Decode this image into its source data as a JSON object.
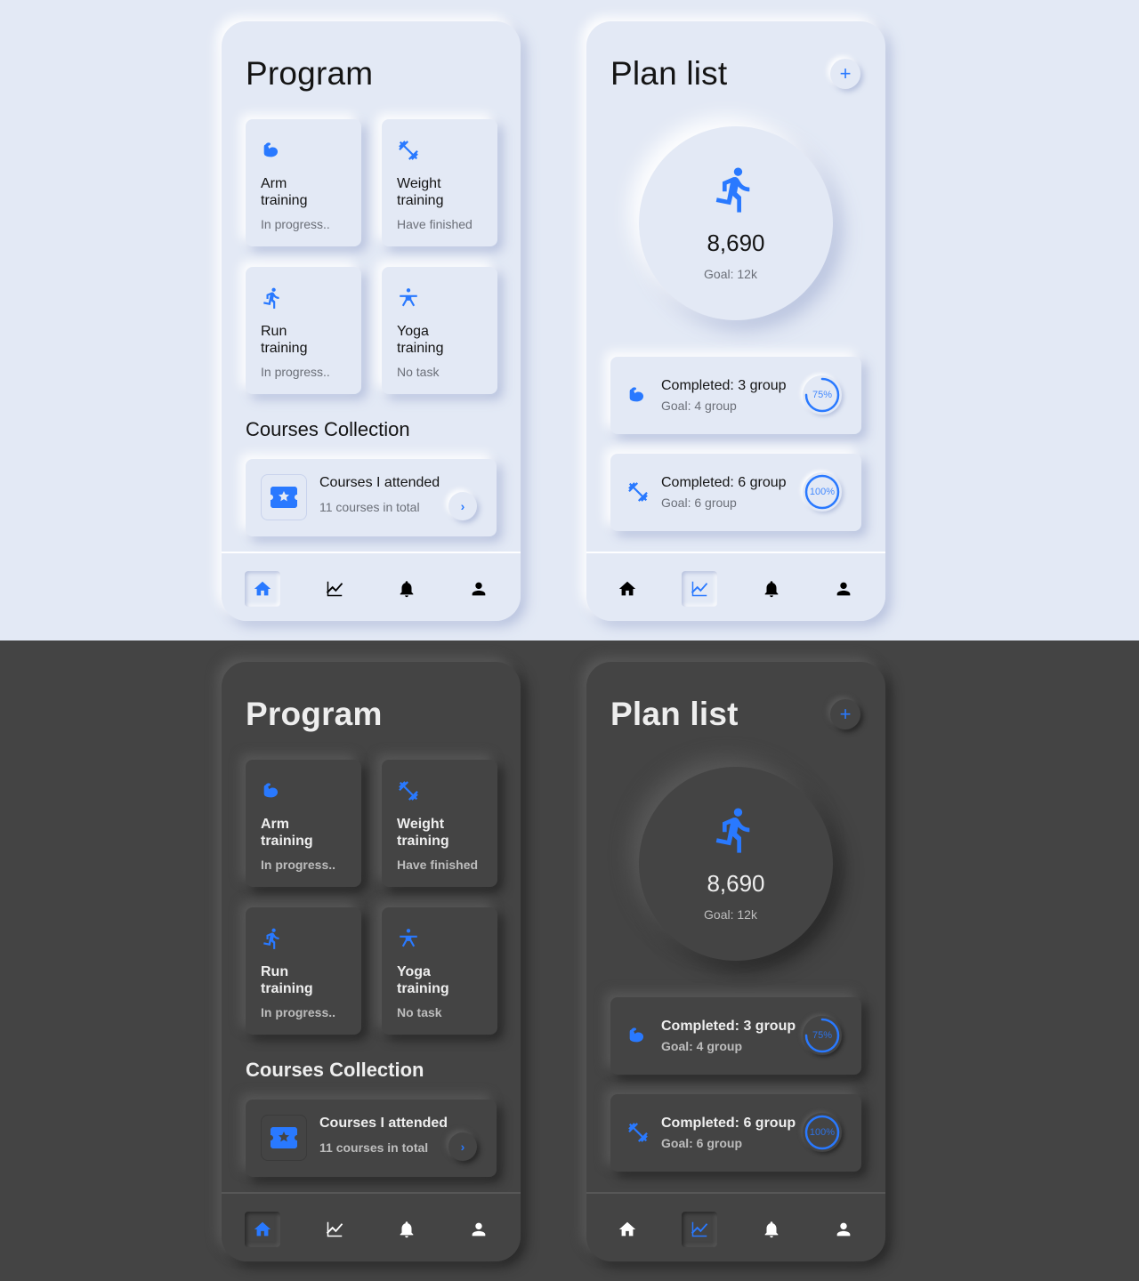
{
  "colors": {
    "accent": "#2979ff",
    "light_bg": "#e3e9f5",
    "dark_bg": "#444444"
  },
  "program": {
    "title": "Program",
    "cards": [
      {
        "icon": "arm-muscle-icon",
        "title_line1": "Arm",
        "title_line2": "training",
        "status": "In progress.."
      },
      {
        "icon": "dumbbell-icon",
        "title_line1": "Weight",
        "title_line2": "training",
        "status": "Have finished"
      },
      {
        "icon": "run-icon",
        "title_line1": "Run",
        "title_line2": "training",
        "status": "In progress.."
      },
      {
        "icon": "yoga-icon",
        "title_line1": "Yoga",
        "title_line2": "training",
        "status": "No task"
      }
    ],
    "section_title": "Courses Collection",
    "course": {
      "icon": "ticket-star-icon",
      "title": "Courses I attended",
      "subtitle": "11 courses in total",
      "action_icon": "chevron-right-icon"
    },
    "nav_active": "home"
  },
  "plan": {
    "title": "Plan list",
    "add_icon": "plus-icon",
    "steps": {
      "icon": "run-icon",
      "value": "8,690",
      "goal": "Goal: 12k"
    },
    "items": [
      {
        "icon": "arm-muscle-icon",
        "title": "Completed: 3 group",
        "goal": "Goal: 4 group",
        "percent_label": "75%",
        "progress": 0.75
      },
      {
        "icon": "dumbbell-icon",
        "title": "Completed: 6 group",
        "goal": "Goal: 6 group",
        "percent_label": "100%",
        "progress": 1.0
      }
    ],
    "nav_active": "stats"
  },
  "nav": [
    {
      "id": "home",
      "icon": "home-icon"
    },
    {
      "id": "stats",
      "icon": "chart-icon"
    },
    {
      "id": "notifications",
      "icon": "bell-icon"
    },
    {
      "id": "profile",
      "icon": "person-icon"
    }
  ]
}
